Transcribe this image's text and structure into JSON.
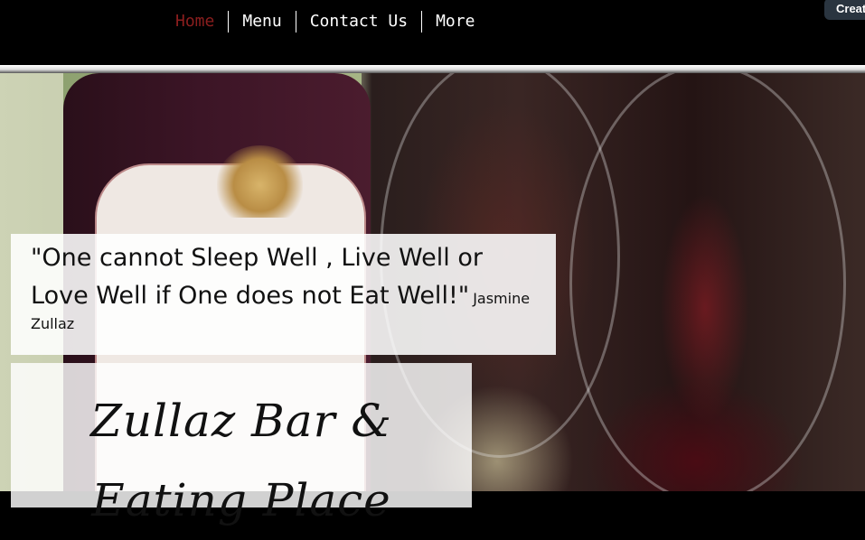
{
  "nav": {
    "items": [
      {
        "label": "Home",
        "active": true
      },
      {
        "label": "Menu",
        "active": false
      },
      {
        "label": "Contact Us",
        "active": false
      },
      {
        "label": "More",
        "active": false
      }
    ],
    "active_color": "#8b1e1e"
  },
  "create_button": {
    "label": "Creat"
  },
  "hero": {
    "quote": {
      "text": "\"One cannot Sleep Well , Live Well or Love Well if One does not Eat Well!\"",
      "author": "Jasmine Zullaz"
    },
    "title": "Zullaz Bar & Eating Place"
  }
}
